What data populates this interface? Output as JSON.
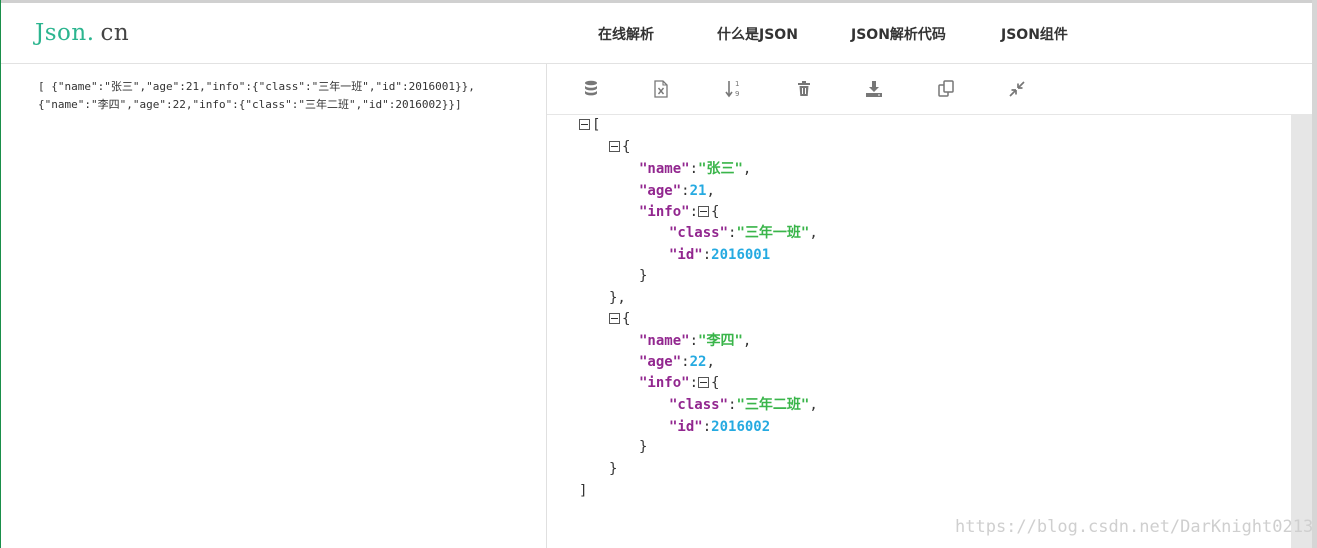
{
  "header": {
    "logo": {
      "main": "Json",
      "dot": ".",
      "suffix": "cn"
    },
    "nav": [
      "在线解析",
      "什么是JSON",
      "JSON解析代码",
      "JSON组件"
    ]
  },
  "input": {
    "line1": "[ {\"name\":\"张三\",\"age\":21,\"info\":{\"class\":\"三年一班\",\"id\":2016001}},",
    "line2": "{\"name\":\"李四\",\"age\":22,\"info\":{\"class\":\"三年二班\",\"id\":2016002}}]"
  },
  "toolbar": {
    "icons": [
      "database-icon",
      "excel-icon",
      "sort-icon",
      "trash-icon",
      "download-icon",
      "copy-icon",
      "compress-icon"
    ]
  },
  "tree": {
    "open_bracket": "[",
    "close_bracket": "]",
    "open_brace": "{",
    "close_brace": "}",
    "close_brace_comma": "},",
    "colon": ":",
    "comma": ",",
    "items": [
      {
        "name_key": "\"name\"",
        "name_val": "\"张三\"",
        "age_key": "\"age\"",
        "age_val": "21",
        "info_key": "\"info\"",
        "class_key": "\"class\"",
        "class_val": "\"三年一班\"",
        "id_key": "\"id\"",
        "id_val": "2016001"
      },
      {
        "name_key": "\"name\"",
        "name_val": "\"李四\"",
        "age_key": "\"age\"",
        "age_val": "22",
        "info_key": "\"info\"",
        "class_key": "\"class\"",
        "class_val": "\"三年二班\"",
        "id_key": "\"id\"",
        "id_val": "2016002"
      }
    ]
  },
  "watermark": "https://blog.csdn.net/DarKnight0213",
  "colors": {
    "brand": "#2cb58f",
    "key": "#92278f",
    "string": "#3ab54a",
    "number": "#25aae1"
  }
}
